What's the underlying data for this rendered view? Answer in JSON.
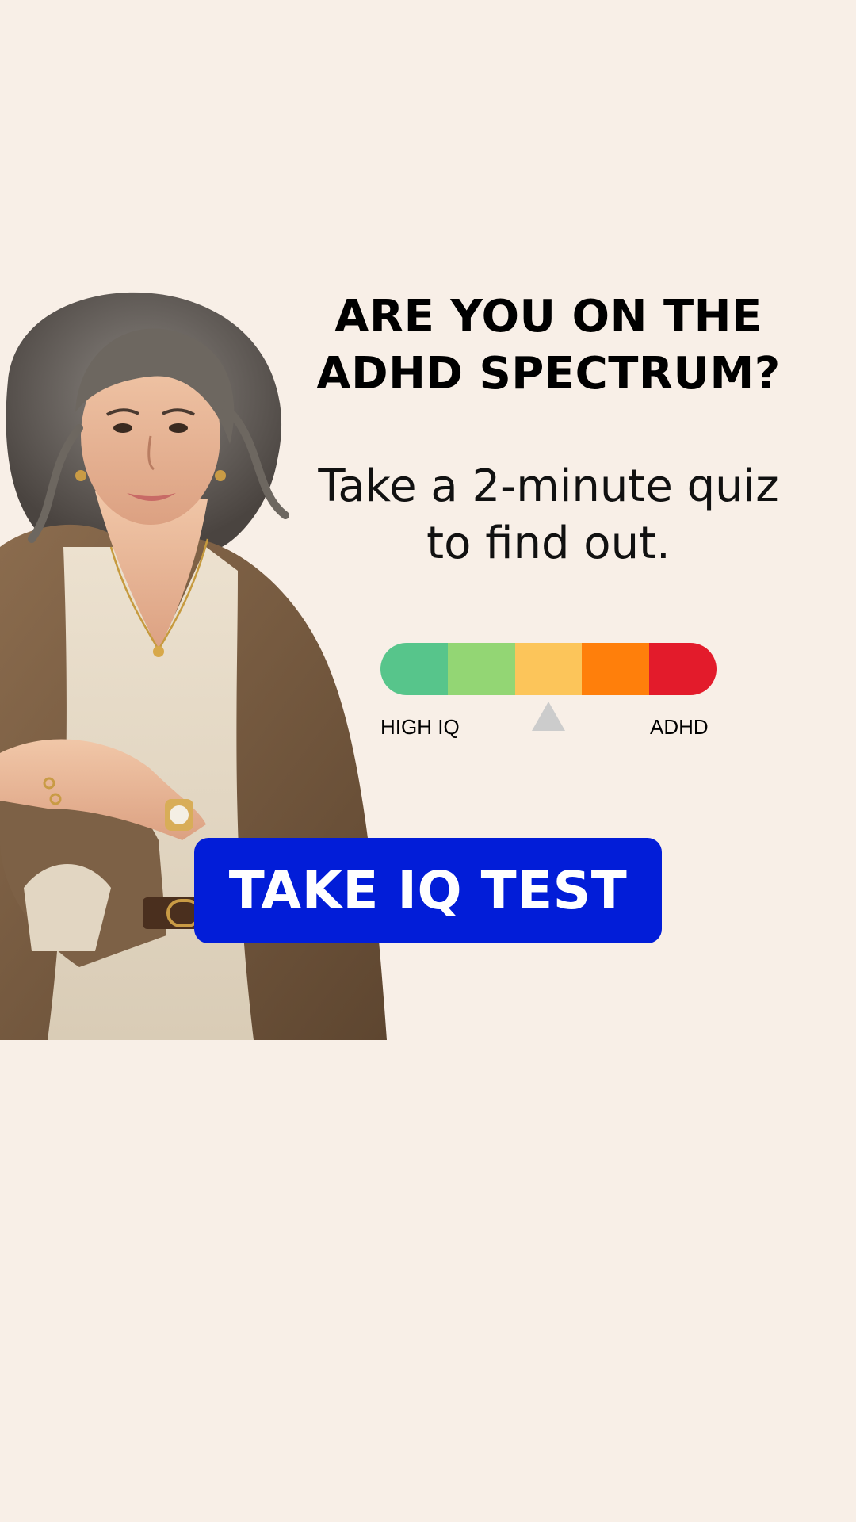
{
  "colors": {
    "background": "#f8efe7",
    "heading_text": "#000000",
    "cta_background": "#021dd8",
    "cta_text": "#ffffff",
    "pointer": "#cccccc",
    "spectrum": [
      "#57c58b",
      "#93d674",
      "#fcc55a",
      "#ff7f0b",
      "#e31b2b"
    ]
  },
  "headline": {
    "lines": [
      "ARE YOU ON THE",
      "ADHD SPECTRUM?"
    ]
  },
  "subhead": {
    "lines": [
      "Take a 2-minute quiz",
      "to find out."
    ]
  },
  "scale": {
    "left_label": "HIGH IQ",
    "right_label": "ADHD",
    "segment_count": 5,
    "pointer_level": 0.5
  },
  "cta": {
    "label": "TAKE IQ TEST"
  },
  "image": {
    "description_icon": "woman-portrait-illustration"
  }
}
